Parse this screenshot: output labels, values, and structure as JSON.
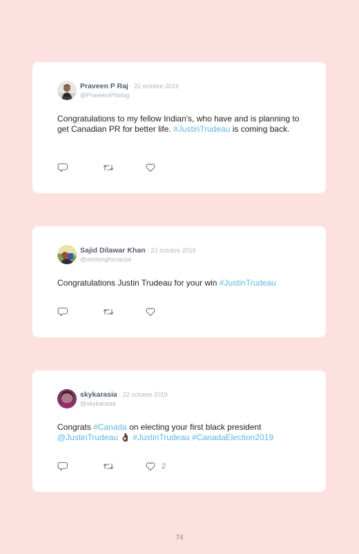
{
  "tweets": [
    {
      "name": "Praveen P Raj",
      "separator": " · ",
      "date": "22 octobre 2019",
      "handle": "@PraveenPhotog",
      "text_parts": [
        "Congratulations to my fellow Indian's, who have and is planning to get Canadian PR for better life. ",
        "#JustinTrudeau",
        " is coming back."
      ],
      "likes": ""
    },
    {
      "name": "Sajid Dilawar Khan",
      "separator": " · ",
      "date": "22 octobre 2019",
      "handle": "@workingforcause",
      "text_parts": [
        "Congratulations Justin Trudeau for your win ",
        "#JustinTrudeau"
      ],
      "likes": ""
    },
    {
      "name": "skykarasia",
      "separator": " · ",
      "date": "22 octobre 2019",
      "handle": "@skykarasia",
      "text_parts": [
        "Congrats ",
        "#Canada",
        " on electing your first black president ",
        "@JustinTrudeau",
        " 👌🏿 ",
        "#JustinTrudeau",
        " ",
        "#CanadaElection2019"
      ],
      "likes": "2"
    }
  ],
  "page_number": "74",
  "colors": {
    "background": "#fde0e0",
    "card": "#ffffff",
    "hashtag": "#5fb6df",
    "name": "#555e6e",
    "meta": "#b2b6bc"
  },
  "icons": [
    "reply-icon",
    "retweet-icon",
    "heart-icon"
  ]
}
